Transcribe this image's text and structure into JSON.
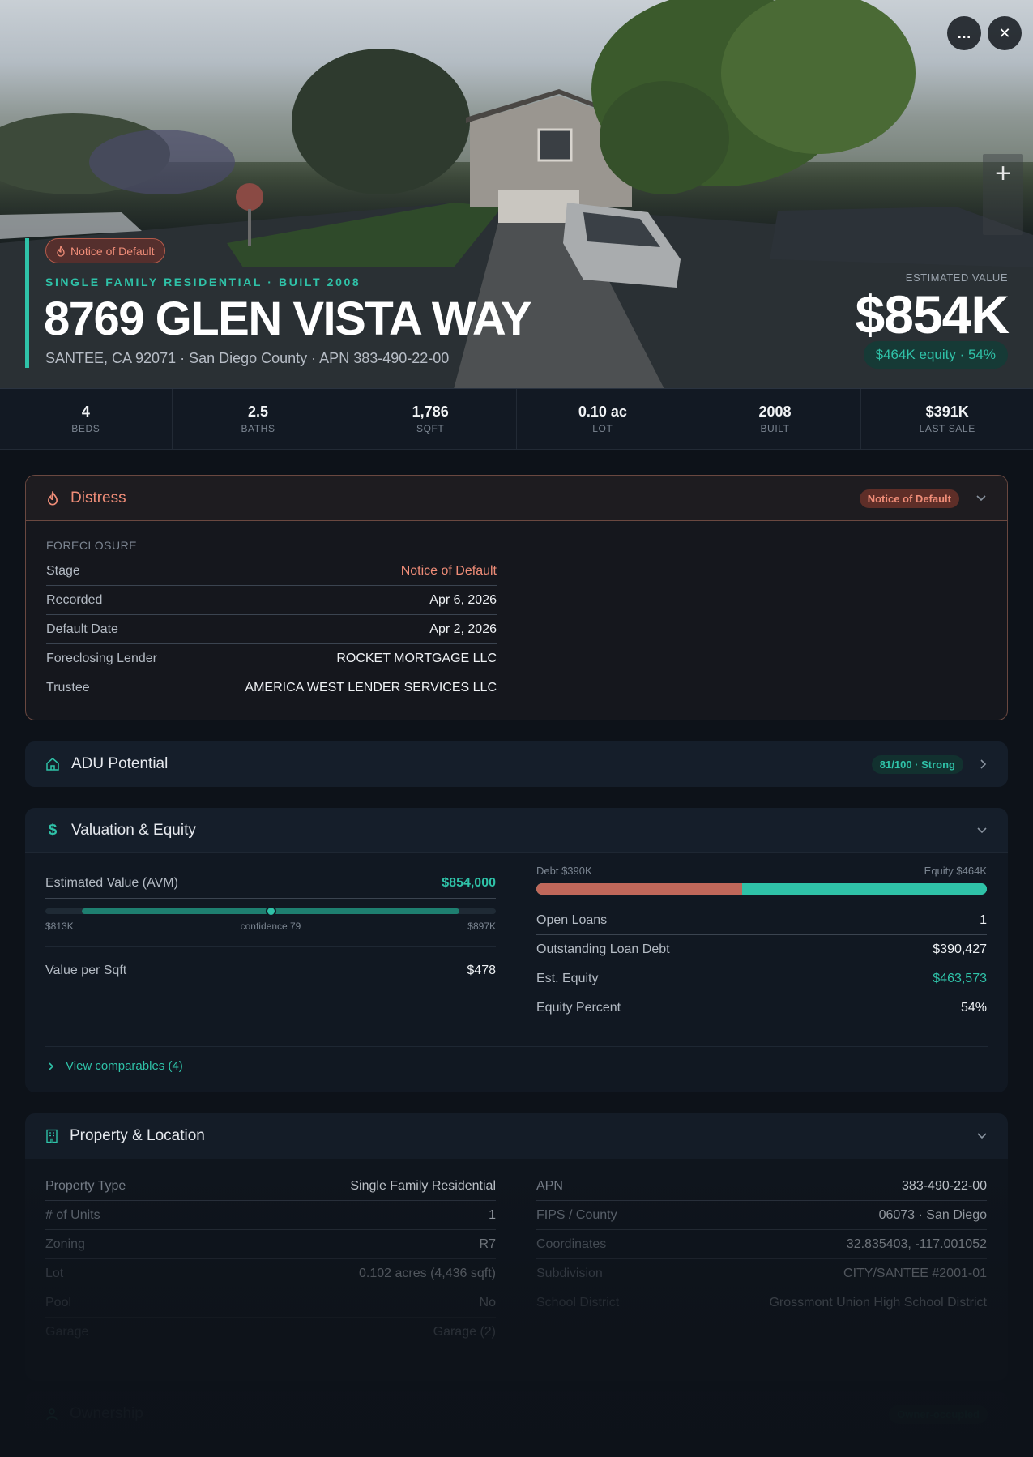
{
  "hero": {
    "distress_badge": "Notice of Default",
    "property_kind": "SINGLE FAMILY RESIDENTIAL · BUILT 2008",
    "address": "8769 GLEN VISTA WAY",
    "location_line": "SANTEE, CA 92071 · San Diego County · APN 383-490-22-00",
    "estimated_value_label": "ESTIMATED VALUE",
    "estimated_value": "$854K",
    "equity_pill": "$464K equity · 54%",
    "more_icon": "…",
    "close_icon": "✕",
    "zoom_plus": "+"
  },
  "stats": [
    {
      "value": "4",
      "label": "BEDS"
    },
    {
      "value": "2.5",
      "label": "BATHS"
    },
    {
      "value": "1,786",
      "label": "SQFT"
    },
    {
      "value": "0.10 ac",
      "label": "LOT"
    },
    {
      "value": "2008",
      "label": "BUILT"
    },
    {
      "value": "$391K",
      "label": "LAST SALE"
    }
  ],
  "distress": {
    "title": "Distress",
    "badge": "Notice of Default",
    "section": "FORECLOSURE",
    "rows": [
      {
        "k": "Stage",
        "v": "Notice of Default"
      },
      {
        "k": "Recorded",
        "v": "Apr 6, 2026"
      },
      {
        "k": "Default Date",
        "v": "Apr 2, 2026"
      },
      {
        "k": "Foreclosing Lender",
        "v": "ROCKET MORTGAGE LLC"
      },
      {
        "k": "Trustee",
        "v": "AMERICA WEST LENDER SERVICES LLC"
      }
    ]
  },
  "adu": {
    "title": "ADU Potential",
    "score": "81/100 · Strong"
  },
  "valuation": {
    "title": "Valuation & Equity",
    "avm_label": "Estimated Value (AVM)",
    "avm_value": "$854,000",
    "range_low": "$813K",
    "range_high": "$897K",
    "confidence": "confidence 79",
    "value_per_sqft_label": "Value per Sqft",
    "value_per_sqft": "$478",
    "debt_label": "Debt $390K",
    "equity_label": "Equity $464K",
    "debt_fraction": 0.457,
    "avm_position_fraction": 0.5,
    "rows": [
      {
        "k": "Open Loans",
        "v": "1"
      },
      {
        "k": "Outstanding Loan Debt",
        "v": "$390,427"
      },
      {
        "k": "Est. Equity",
        "v": "$463,573"
      },
      {
        "k": "Equity Percent",
        "v": "54%"
      }
    ],
    "comparables_link": "View comparables (4)"
  },
  "property": {
    "title": "Property & Location",
    "left_rows": [
      {
        "k": "Property Type",
        "v": "Single Family Residential"
      },
      {
        "k": "# of Units",
        "v": "1"
      },
      {
        "k": "Zoning",
        "v": "R7"
      },
      {
        "k": "Lot",
        "v": "0.102 acres (4,436 sqft)"
      },
      {
        "k": "Pool",
        "v": "No"
      },
      {
        "k": "Garage",
        "v": "Garage (2)"
      }
    ],
    "right_rows": [
      {
        "k": "APN",
        "v": "383-490-22-00"
      },
      {
        "k": "FIPS / County",
        "v": "06073 · San Diego"
      },
      {
        "k": "Coordinates",
        "v": "32.835403, -117.001052"
      },
      {
        "k": "Subdivision",
        "v": "CITY/SANTEE #2001-01"
      },
      {
        "k": "School District",
        "v": "Grossmont Union High School District"
      }
    ]
  },
  "ownership": {
    "title": "Ownership",
    "badge": "Owner-occupied"
  },
  "colors": {
    "accent": "#2fc2a8",
    "distress": "#f08d78",
    "debt": "#c0675a",
    "background": "#0d1219"
  }
}
